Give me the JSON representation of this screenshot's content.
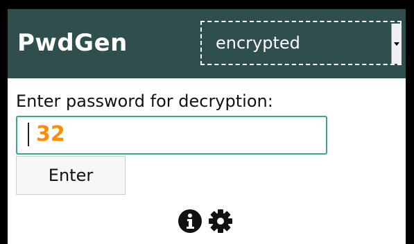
{
  "header": {
    "app_title": "PwdGen",
    "mode_select": {
      "selected": "encrypted"
    }
  },
  "main": {
    "prompt": "Enter password for decryption:",
    "password_input": {
      "value": "32",
      "value_color": "#ff8c00",
      "border_color": "#3aa68c"
    },
    "enter_button_label": "Enter"
  },
  "footer": {
    "icons": [
      "info-icon",
      "gear-icon"
    ]
  },
  "colors": {
    "header_bg": "#2f4f4f",
    "header_text": "#ffffff"
  }
}
